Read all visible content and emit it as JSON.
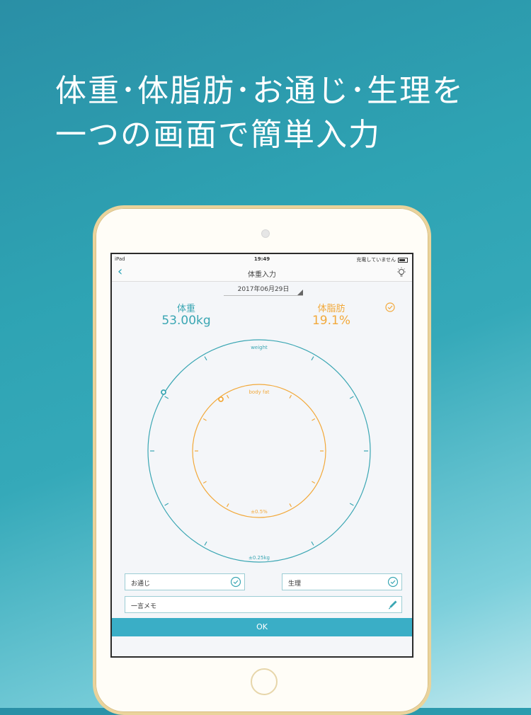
{
  "headline": {
    "line1": "体重･体脂肪･お通じ･生理を",
    "line2": "一つの画面で簡単入力"
  },
  "status_bar": {
    "device": "iPad",
    "time": "19:49",
    "charging": "充電していません"
  },
  "nav": {
    "title": "体重入力",
    "back_icon": "chevron-left-icon",
    "hint_icon": "lightbulb-icon"
  },
  "date": "2017年06月29日",
  "weight": {
    "label": "体重",
    "value": "53.00kg"
  },
  "body_fat": {
    "label": "体脂肪",
    "value": "19.1%"
  },
  "dial": {
    "outer_label": "weight",
    "outer_step": "±0.25kg",
    "inner_label": "body fat",
    "inner_step": "±0.5%"
  },
  "fields": {
    "otsuji": "お通じ",
    "seiri": "生理",
    "memo": "一言メモ"
  },
  "ok_label": "OK",
  "colors": {
    "accent": "#3aa6b3",
    "fat": "#f2a93b",
    "ok": "#3aaec6"
  }
}
